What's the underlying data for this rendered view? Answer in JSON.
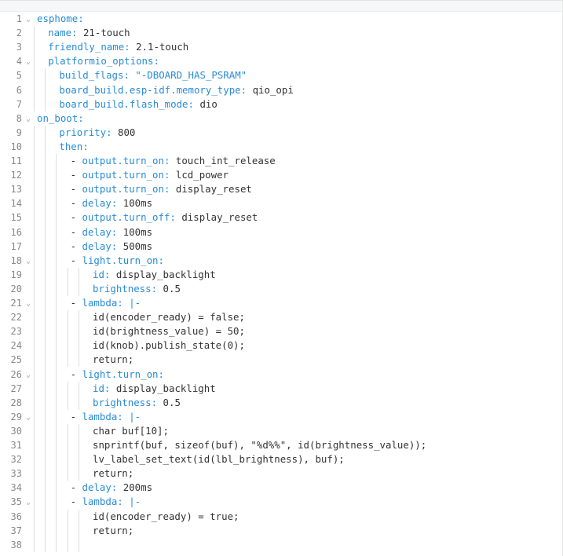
{
  "editor": {
    "lines": [
      {
        "n": "1",
        "indent": 0,
        "fold": true,
        "dash": false,
        "key": "esphome",
        "sep": ":",
        "val": ""
      },
      {
        "n": "2",
        "indent": 1,
        "fold": false,
        "dash": false,
        "key": "name",
        "sep": ":",
        "val": " 21-touch"
      },
      {
        "n": "3",
        "indent": 1,
        "fold": false,
        "dash": false,
        "key": "friendly_name",
        "sep": ":",
        "val": " 2.1-touch"
      },
      {
        "n": "4",
        "indent": 1,
        "fold": true,
        "dash": false,
        "key": "platformio_options",
        "sep": ":",
        "val": ""
      },
      {
        "n": "5",
        "indent": 2,
        "fold": false,
        "dash": false,
        "key": "build_flags",
        "sep": ":",
        "val": "",
        "str": " \"-DBOARD_HAS_PSRAM\""
      },
      {
        "n": "6",
        "indent": 2,
        "fold": false,
        "dash": false,
        "key": "board_build.esp-idf.memory_type",
        "sep": ":",
        "val": " qio_opi"
      },
      {
        "n": "7",
        "indent": 2,
        "fold": false,
        "dash": false,
        "key": "board_build.flash_mode",
        "sep": ":",
        "val": " dio"
      },
      {
        "n": "8",
        "indent": 0,
        "fold": true,
        "dash": false,
        "key": "on_boot",
        "sep": ":",
        "val": ""
      },
      {
        "n": "9",
        "indent": 2,
        "fold": false,
        "dash": false,
        "key": "priority",
        "sep": ":",
        "val": " 800"
      },
      {
        "n": "10",
        "indent": 2,
        "fold": false,
        "dash": false,
        "key": "then",
        "sep": ":",
        "val": ""
      },
      {
        "n": "11",
        "indent": 3,
        "fold": false,
        "dash": true,
        "key": "output.turn_on",
        "sep": ":",
        "val": " touch_int_release"
      },
      {
        "n": "12",
        "indent": 3,
        "fold": false,
        "dash": true,
        "key": "output.turn_on",
        "sep": ":",
        "val": " lcd_power"
      },
      {
        "n": "13",
        "indent": 3,
        "fold": false,
        "dash": true,
        "key": "output.turn_on",
        "sep": ":",
        "val": " display_reset"
      },
      {
        "n": "14",
        "indent": 3,
        "fold": false,
        "dash": true,
        "key": "delay",
        "sep": ":",
        "val": " 100ms"
      },
      {
        "n": "15",
        "indent": 3,
        "fold": false,
        "dash": true,
        "key": "output.turn_off",
        "sep": ":",
        "val": " display_reset"
      },
      {
        "n": "16",
        "indent": 3,
        "fold": false,
        "dash": true,
        "key": "delay",
        "sep": ":",
        "val": " 100ms"
      },
      {
        "n": "17",
        "indent": 3,
        "fold": false,
        "dash": true,
        "key": "delay",
        "sep": ":",
        "val": " 500ms"
      },
      {
        "n": "18",
        "indent": 3,
        "fold": true,
        "dash": true,
        "key": "light.turn_on",
        "sep": ":",
        "val": ""
      },
      {
        "n": "19",
        "indent": 5,
        "fold": false,
        "dash": false,
        "key": "id",
        "sep": ":",
        "val": " display_backlight"
      },
      {
        "n": "20",
        "indent": 5,
        "fold": false,
        "dash": false,
        "key": "brightness",
        "sep": ":",
        "val": " 0.5"
      },
      {
        "n": "21",
        "indent": 3,
        "fold": true,
        "dash": true,
        "key": "lambda",
        "sep": ":",
        "val": "",
        "str": " |-"
      },
      {
        "n": "22",
        "indent": 5,
        "fold": false,
        "dash": false,
        "key": "",
        "sep": "",
        "val": "id(encoder_ready) = false;"
      },
      {
        "n": "23",
        "indent": 5,
        "fold": false,
        "dash": false,
        "key": "",
        "sep": "",
        "val": "id(brightness_value) = 50;"
      },
      {
        "n": "24",
        "indent": 5,
        "fold": false,
        "dash": false,
        "key": "",
        "sep": "",
        "val": "id(knob).publish_state(0);"
      },
      {
        "n": "25",
        "indent": 5,
        "fold": false,
        "dash": false,
        "key": "",
        "sep": "",
        "val": "return;"
      },
      {
        "n": "26",
        "indent": 3,
        "fold": true,
        "dash": true,
        "key": "light.turn_on",
        "sep": ":",
        "val": ""
      },
      {
        "n": "27",
        "indent": 5,
        "fold": false,
        "dash": false,
        "key": "id",
        "sep": ":",
        "val": " display_backlight"
      },
      {
        "n": "28",
        "indent": 5,
        "fold": false,
        "dash": false,
        "key": "brightness",
        "sep": ":",
        "val": " 0.5"
      },
      {
        "n": "29",
        "indent": 3,
        "fold": true,
        "dash": true,
        "key": "lambda",
        "sep": ":",
        "val": "",
        "str": " |-"
      },
      {
        "n": "30",
        "indent": 5,
        "fold": false,
        "dash": false,
        "key": "",
        "sep": "",
        "val": "char buf[10];"
      },
      {
        "n": "31",
        "indent": 5,
        "fold": false,
        "dash": false,
        "key": "",
        "sep": "",
        "val": "snprintf(buf, sizeof(buf), \"%d%%\", id(brightness_value));"
      },
      {
        "n": "32",
        "indent": 5,
        "fold": false,
        "dash": false,
        "key": "",
        "sep": "",
        "val": "lv_label_set_text(id(lbl_brightness), buf);"
      },
      {
        "n": "33",
        "indent": 5,
        "fold": false,
        "dash": false,
        "key": "",
        "sep": "",
        "val": "return;"
      },
      {
        "n": "34",
        "indent": 3,
        "fold": false,
        "dash": true,
        "key": "delay",
        "sep": ":",
        "val": " 200ms"
      },
      {
        "n": "35",
        "indent": 3,
        "fold": true,
        "dash": true,
        "key": "lambda",
        "sep": ":",
        "val": "",
        "str": " |-"
      },
      {
        "n": "36",
        "indent": 5,
        "fold": false,
        "dash": false,
        "key": "",
        "sep": "",
        "val": "id(encoder_ready) = true;"
      },
      {
        "n": "37",
        "indent": 5,
        "fold": false,
        "dash": false,
        "key": "",
        "sep": "",
        "val": "return;"
      },
      {
        "n": "38",
        "indent": 0,
        "fold": false,
        "dash": false,
        "key": "",
        "sep": "",
        "val": ""
      }
    ]
  },
  "colors": {
    "key": "#2a8bd6",
    "text": "#333333",
    "line_number": "#888888",
    "guide": "#dcdcdc"
  },
  "icons": {
    "fold": "chevron-down-icon"
  }
}
